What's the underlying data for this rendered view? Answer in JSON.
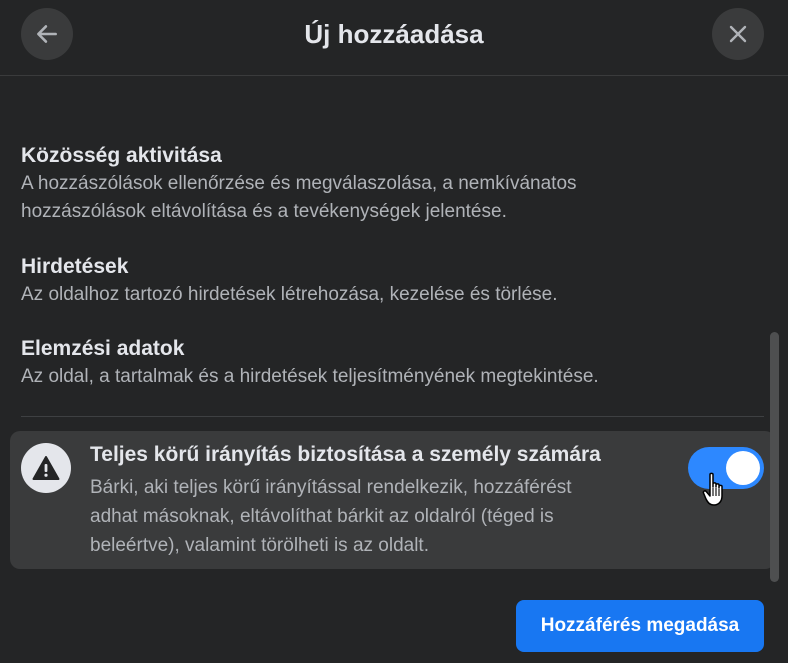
{
  "dialog": {
    "title": "Új hozzáadása"
  },
  "permissions": [
    {
      "title": "Közösség aktivitása",
      "description_lines": [
        "A hozzászólások ellenőrzése és megválaszolása, a nemkívánatos",
        "hozzászólások eltávolítása és a tevékenységek jelentése."
      ]
    },
    {
      "title": "Hirdetések",
      "description_lines": [
        "Az oldalhoz tartozó hirdetések létrehozása, kezelése és törlése."
      ]
    },
    {
      "title": "Elemzési adatok",
      "description_lines": [
        "Az oldal, a tartalmak és a hirdetések teljesítményének megtekintése."
      ]
    }
  ],
  "full_control": {
    "title": "Teljes körű irányítás biztosítása a személy számára",
    "description_lines": [
      "Bárki, aki teljes körű irányítással rendelkezik, hozzáférést",
      "adhat másoknak, eltávolíthat bárkit az oldalról (téged is",
      "beleértve), valamint törölheti is az oldalt."
    ],
    "enabled": true,
    "icon": "warning-icon"
  },
  "footer": {
    "grant_label": "Hozzáférés megadása"
  },
  "icons": {
    "back": "arrow-left-icon",
    "close": "close-icon",
    "cursor": "hand-pointer-icon"
  },
  "colors": {
    "accent": "#1877f2",
    "toggle_on": "#2d88ff",
    "background": "#242526",
    "panel": "#3a3b3c"
  }
}
